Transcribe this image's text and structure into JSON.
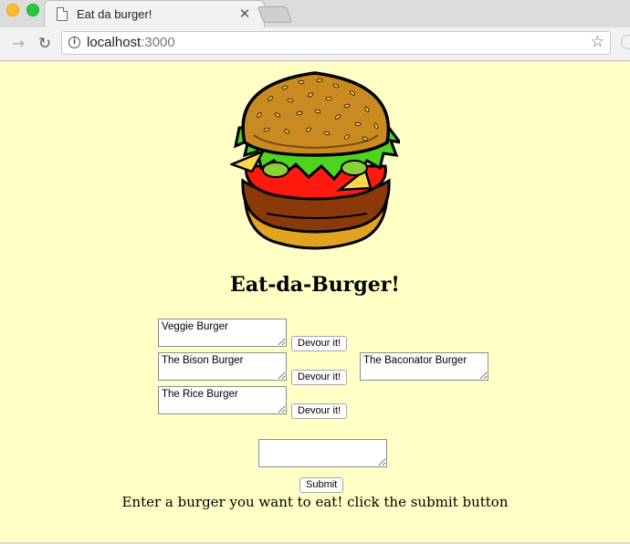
{
  "browser": {
    "tab_title": "Eat da burger!",
    "tab_close": "✕",
    "url_host": "localhost",
    "url_port": ":3000",
    "icons": [
      "page-icon",
      "close-icon",
      "forward-icon",
      "reload-icon",
      "info-icon",
      "star-icon"
    ]
  },
  "page": {
    "heading": "Eat-da-Burger!",
    "burgers_to_devour": [
      {
        "name": "Veggie Burger",
        "button": "Devour it!"
      },
      {
        "name": "The Bison Burger",
        "button": "Devour it!"
      },
      {
        "name": "The Rice Burger",
        "button": "Devour it!"
      }
    ],
    "devoured_burgers": [
      {
        "name": "The Baconator Burger"
      }
    ],
    "new_burger_input": "",
    "submit_label": "Submit",
    "instructions": "Enter a burger you want to eat! click the submit button"
  },
  "colors": {
    "page_background": "#ffffc6"
  }
}
